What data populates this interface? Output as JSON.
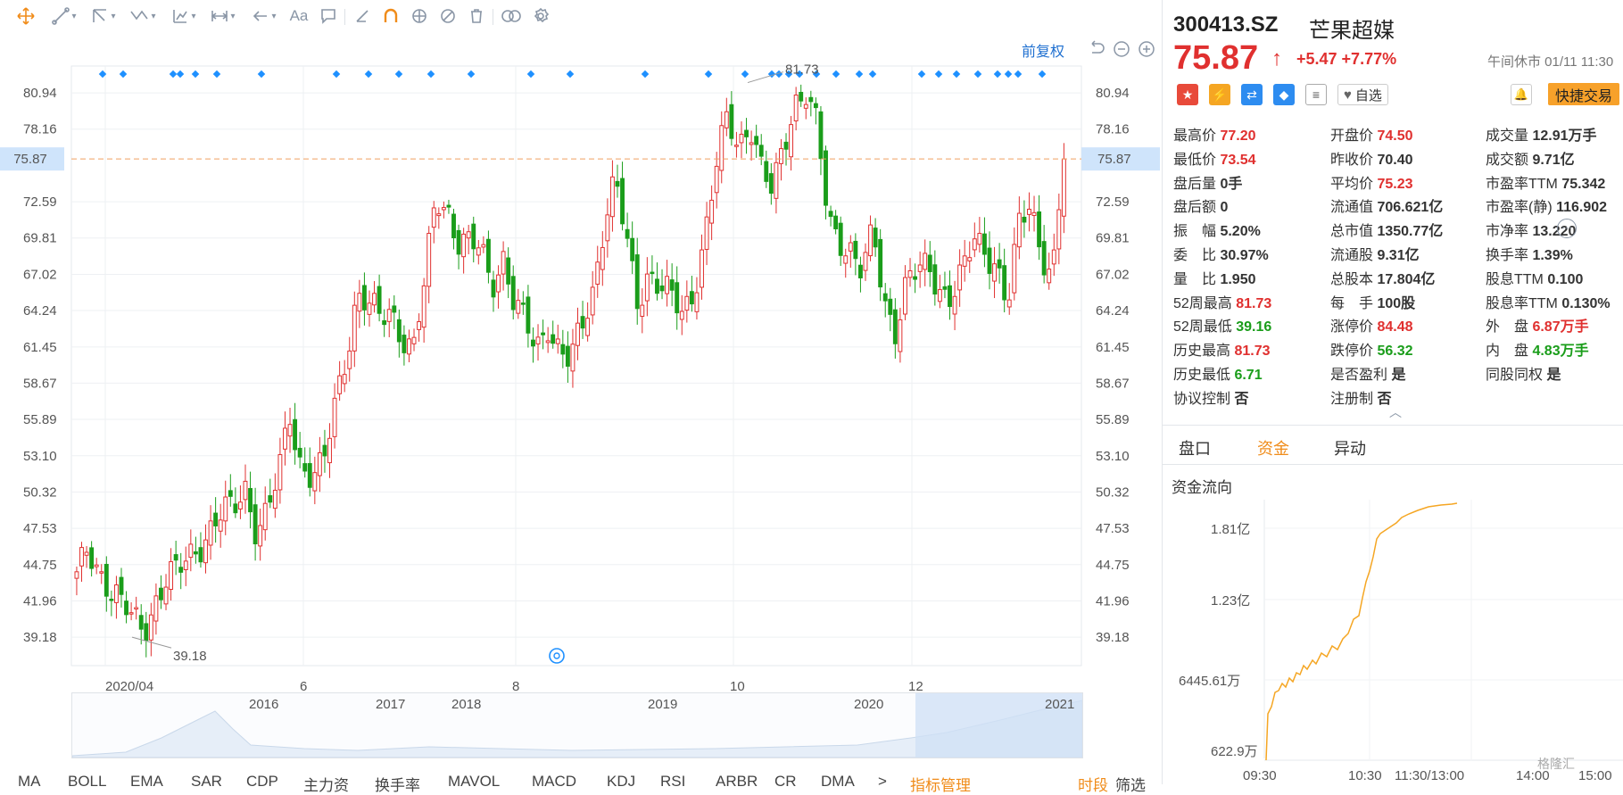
{
  "toolbar": {
    "items": [
      "move-icon",
      "line-icon",
      "ray-icon",
      "polyline-icon",
      "rect-icon",
      "measure-icon",
      "arrow-icon",
      "text-icon",
      "comment-icon",
      "ruler-icon",
      "magnet-icon",
      "eye-icon",
      "eye-off-icon",
      "trash-icon",
      "link-icon",
      "settings-icon"
    ],
    "text_label": "Aa"
  },
  "chart": {
    "adjust_label": "前复权",
    "current_price_label": "75.87",
    "high_label": "81.73",
    "low_label": "39.18",
    "y_ticks": [
      "80.94",
      "78.16",
      "75.87",
      "72.59",
      "69.81",
      "67.02",
      "64.24",
      "61.45",
      "58.67",
      "55.89",
      "53.10",
      "50.32",
      "47.53",
      "44.75",
      "41.96",
      "39.18"
    ],
    "x_ticks": [
      "2020/04",
      "6",
      "8",
      "10",
      "12"
    ],
    "nav_years": [
      "2016",
      "2017",
      "2018",
      "2019",
      "2020",
      "2021"
    ],
    "colors": {
      "up": "#e0302f",
      "down": "#1a9d1a",
      "dot": "#1e90ff",
      "grid": "#eef0f3",
      "current": "#f0a060"
    }
  },
  "chart_data": {
    "type": "candlestick",
    "title": "",
    "ylim": [
      37.0,
      83.0
    ],
    "high": 81.73,
    "low": 39.18,
    "last": 75.87,
    "approx_close_series": [
      43.5,
      46.0,
      44.5,
      43.0,
      41.5,
      40.5,
      40.0,
      42.0,
      43.5,
      44.0,
      45.5,
      46.5,
      47.5,
      48.5,
      49.0,
      51.0,
      47.5,
      48.5,
      51.5,
      56.5,
      52.5,
      51.5,
      52.0,
      57.0,
      61.0,
      65.5,
      64.5,
      63.5,
      64.5,
      62.5,
      61.0,
      66.0,
      73.0,
      72.5,
      69.5,
      69.0,
      69.0,
      66.5,
      68.5,
      64.5,
      63.0,
      61.5,
      63.5,
      61.0,
      60.0,
      63.0,
      66.0,
      71.0,
      74.0,
      69.5,
      65.0,
      67.5,
      66.0,
      65.0,
      64.0,
      66.0,
      70.0,
      75.0,
      79.0,
      77.0,
      79.0,
      75.0,
      73.0,
      77.0,
      80.5,
      81.0,
      78.0,
      71.0,
      70.0,
      69.0,
      67.0,
      70.0,
      65.0,
      63.0,
      66.5,
      67.0,
      67.5,
      66.0,
      65.5,
      67.0,
      69.5,
      69.0,
      68.0,
      64.5,
      70.5,
      72.5,
      69.0,
      67.0,
      75.87
    ]
  },
  "panel": {
    "code": "300413.SZ",
    "name": "芒果超媒",
    "price": "75.87",
    "arrow": "↑",
    "change": "+5.47 +7.77%",
    "market_status": "午间休市 01/11 11:30",
    "fav_label": "自选",
    "trade_label": "快捷交易",
    "col1": [
      {
        "k": "最高价",
        "v": "77.20",
        "c": "red"
      },
      {
        "k": "最低价",
        "v": "73.54",
        "c": "red"
      },
      {
        "k": "盘后量",
        "v": "0手",
        "c": ""
      },
      {
        "k": "盘后额",
        "v": "0",
        "c": ""
      },
      {
        "k": "振　幅",
        "v": "5.20%",
        "c": ""
      },
      {
        "k": "委　比",
        "v": "30.97%",
        "c": ""
      },
      {
        "k": "量　比",
        "v": "1.950",
        "c": ""
      },
      {
        "k": "52周最高",
        "v": "81.73",
        "c": "red"
      },
      {
        "k": "52周最低",
        "v": "39.16",
        "c": "green"
      },
      {
        "k": "历史最高",
        "v": "81.73",
        "c": "red"
      },
      {
        "k": "历史最低",
        "v": "6.71",
        "c": "green"
      },
      {
        "k": "协议控制",
        "v": "否",
        "c": ""
      }
    ],
    "col2": [
      {
        "k": "开盘价",
        "v": "74.50",
        "c": "red"
      },
      {
        "k": "昨收价",
        "v": "70.40",
        "c": ""
      },
      {
        "k": "平均价",
        "v": "75.23",
        "c": "red"
      },
      {
        "k": "流通值",
        "v": "706.621亿",
        "c": ""
      },
      {
        "k": "总市值",
        "v": "1350.77亿",
        "c": ""
      },
      {
        "k": "流通股",
        "v": "9.31亿",
        "c": ""
      },
      {
        "k": "总股本",
        "v": "17.804亿",
        "c": ""
      },
      {
        "k": "每　手",
        "v": "100股",
        "c": ""
      },
      {
        "k": "涨停价",
        "v": "84.48",
        "c": "red"
      },
      {
        "k": "跌停价",
        "v": "56.32",
        "c": "green"
      },
      {
        "k": "是否盈利",
        "v": "是",
        "c": ""
      },
      {
        "k": "注册制",
        "v": "否",
        "c": ""
      }
    ],
    "col3": [
      {
        "k": "成交量",
        "v": "12.91万手",
        "c": ""
      },
      {
        "k": "成交额",
        "v": "9.71亿",
        "c": ""
      },
      {
        "k": "市盈率TTM",
        "v": "75.342",
        "c": ""
      },
      {
        "k": "市盈率(静)",
        "v": "116.902",
        "c": ""
      },
      {
        "k": "市净率",
        "v": "13.220",
        "c": ""
      },
      {
        "k": "换手率",
        "v": "1.39%",
        "c": ""
      },
      {
        "k": "股息TTM",
        "v": "0.100",
        "c": ""
      },
      {
        "k": "股息率TTM",
        "v": "0.130%",
        "c": ""
      },
      {
        "k": "外　盘",
        "v": "6.87万手",
        "c": "red"
      },
      {
        "k": "内　盘",
        "v": "4.83万手",
        "c": "green"
      },
      {
        "k": "同股同权",
        "v": "是",
        "c": ""
      }
    ],
    "tabs": [
      "盘口",
      "资金",
      "异动"
    ],
    "fund_title": "资金流向",
    "fund_y": [
      "1.81亿",
      "1.23亿",
      "6445.61万",
      "622.9万"
    ],
    "fund_x": [
      "09:30",
      "10:30",
      "11:30/13:00",
      "14:00",
      "15:00"
    ]
  },
  "bottom_tabs": [
    "MA",
    "BOLL",
    "EMA",
    "SAR",
    "CDP",
    "主力资",
    "换手率",
    "MAVOL",
    "MACD",
    "KDJ",
    "RSI",
    "ARBR",
    "CR",
    "DMA",
    ">",
    "指标管理",
    "时段",
    "筛选"
  ],
  "watermark": "格隆汇"
}
